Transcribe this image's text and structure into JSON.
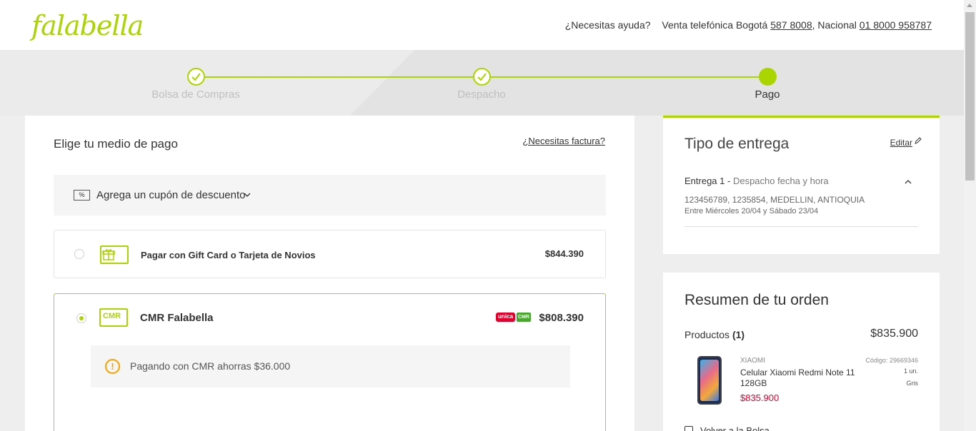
{
  "header": {
    "logo": "falabella",
    "help_label": "¿Necesitas ayuda?",
    "phone_label": "Venta telefónica Bogotá",
    "phone_bogota": "587 8008",
    "national_label": "Nacional",
    "phone_national": "01 8000 958787"
  },
  "stepper": {
    "steps": [
      {
        "label": "Bolsa de Compras",
        "status": "done"
      },
      {
        "label": "Despacho",
        "status": "done"
      },
      {
        "label": "Pago",
        "status": "active"
      }
    ]
  },
  "payment": {
    "title": "Elige tu medio de pago",
    "invoice_link": "¿Necesitas factura?",
    "coupon": {
      "icon_text": "%",
      "label": "Agrega un cupón de descuento"
    },
    "options": [
      {
        "label": "Pagar con Gift Card o Tarjeta de Novios",
        "price": "$844.390",
        "selected": false,
        "icon": "gift-card-icon"
      },
      {
        "label": "CMR Falabella",
        "price": "$808.390",
        "selected": true,
        "icon": "cmr-card-icon",
        "icon_text": "CMR",
        "badges": [
          "unica",
          "CMR"
        ]
      }
    ],
    "notice": "Pagando con CMR ahorras $36.000"
  },
  "delivery": {
    "title": "Tipo de entrega",
    "edit": "Editar",
    "entry_label": "Entrega 1 -",
    "entry_type": "Despacho fecha y hora",
    "address": "123456789, 1235854, MEDELLIN, ANTIOQUIA",
    "date": "Entre Miércoles 20/04 y Sábado 23/04"
  },
  "summary": {
    "title": "Resumen de tu orden",
    "products_label": "Productos",
    "products_count": "(1)",
    "total": "$835.900",
    "item": {
      "brand": "XIAOMI",
      "name": "Celular Xiaomi Redmi Note 11 128GB",
      "price": "$835.900",
      "code": "Código: 29669346",
      "qty": "1 un.",
      "color": "Gris"
    },
    "back_link": "Volver a la Bolsa"
  },
  "colors": {
    "accent": "#aad500",
    "price_red": "#e4002b",
    "warning": "#f5a200"
  }
}
